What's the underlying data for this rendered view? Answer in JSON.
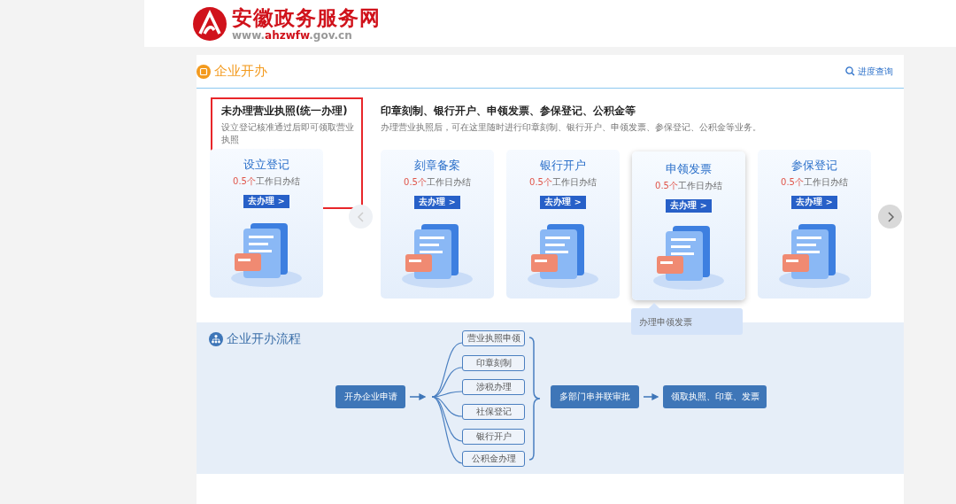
{
  "header": {
    "site_name": "安徽政务服务网",
    "url": [
      {
        "text": "www.",
        "highlighted": false
      },
      {
        "text": "ahzwfw",
        "highlighted": true
      },
      {
        "text": ".gov.cn",
        "highlighted": false
      }
    ]
  },
  "section": {
    "title": "企业开办",
    "link": "进度查询"
  },
  "left_group": {
    "title": "未办理营业执照(统一办理)",
    "description": "设立登记核准通过后即可领取营业执照",
    "outlined": true,
    "cards": [
      {
        "title": "设立登记",
        "time_highlight": "0.5个",
        "time_rest": "工作日办结",
        "button": "去办理 >",
        "highlighted": false
      }
    ]
  },
  "right_group": {
    "title": "印章刻制、银行开户、申领发票、参保登记、公积金等",
    "description": "办理营业执照后，可在这里随时进行印章刻制、银行开户、申领发票、参保登记、公积金等业务。",
    "cards": [
      {
        "title": "刻章备案",
        "time_highlight": "0.5个",
        "time_rest": "工作日办结",
        "button": "去办理 >",
        "highlighted": false
      },
      {
        "title": "银行开户",
        "time_highlight": "0.5个",
        "time_rest": "工作日办结",
        "button": "去办理 >",
        "highlighted": false
      },
      {
        "title": "申领发票",
        "time_highlight": "0.5个",
        "time_rest": "工作日办结",
        "button": "去办理 >",
        "highlighted": true,
        "tooltip": "办理申领发票"
      },
      {
        "title": "参保登记",
        "time_highlight": "0.5个",
        "time_rest": "工作日办结",
        "button": "去办理 >",
        "highlighted": false
      }
    ]
  },
  "flow": {
    "title": "企业开办流程",
    "start": "开办企业申请",
    "branches": [
      "营业执照申领",
      "印章刻制",
      "涉税办理",
      "社保登记",
      "银行开户",
      "公积金办理"
    ],
    "merge": "多部门串并联审批",
    "end": "领取执照、印章、发票"
  }
}
